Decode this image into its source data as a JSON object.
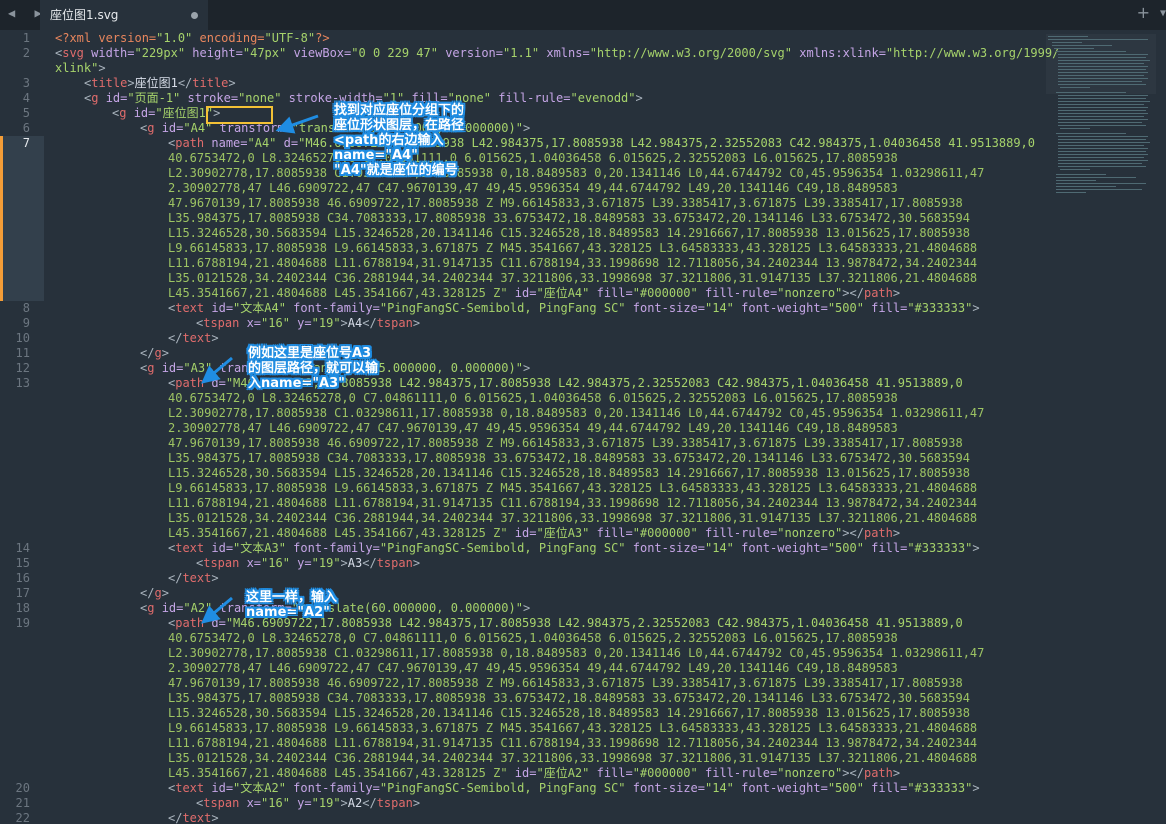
{
  "window": {
    "tab_title": "座位图1.svg",
    "nav_arrows": "◀ ▶",
    "new_tab": "+",
    "tab_menu": "▼"
  },
  "gutter": {
    "lines": [
      "1",
      "2",
      "3",
      "4",
      "5",
      "6",
      "7",
      "8",
      "9",
      "10",
      "11",
      "12",
      "13",
      "14",
      "15",
      "16",
      "17",
      "18",
      "19",
      "20",
      "21",
      "22"
    ],
    "current_line": "7"
  },
  "code": {
    "l1": {
      "a": "<?xml version=",
      "b": "\"1.0\"",
      "c": " encoding=",
      "d": "\"UTF-8\"",
      "e": "?>"
    },
    "l2": {
      "tag": "svg",
      "w_attr": " width=",
      "w_val": "\"229px\"",
      "h_attr": " height=",
      "h_val": "\"47px\"",
      "vb_attr": " viewBox=",
      "vb_val": "\"0 0 229 47\"",
      "v_attr": " version=",
      "v_val": "\"1.1\"",
      "x_attr": " xmlns=",
      "x_val": "\"http://www.w3.org/2000/svg\"",
      "xl_attr": " xmlns:xlink=",
      "xl_val": "\"http://www.w3.org/1999/"
    },
    "l2b": {
      "text": "xlink\"",
      "end": ">"
    },
    "l3": {
      "tag": "title",
      "text": "座位图1",
      "close": "title"
    },
    "l4": {
      "tag": "g",
      "id_attr": " id=",
      "id_val": "\"页面-1\"",
      "st_attr": " stroke=",
      "st_val": "\"none\"",
      "sw_attr": " stroke-width=",
      "sw_val": "\"1\"",
      "f_attr": " fill=",
      "f_val": "\"none\"",
      "fr_attr": " fill-rule=",
      "fr_val": "\"evenodd\""
    },
    "l5": {
      "tag": "g",
      "id_attr": " id=",
      "id_val": "\"座位图1\""
    },
    "l6": {
      "tag": "g",
      "id_attr": " id=",
      "id_val": "\"A4\"",
      "tr_attr": " transform=",
      "tr_val": "\"translate(90.000000, 0.000000)\""
    },
    "l7": {
      "tag": "path",
      "n_attr": " name=",
      "n_val": "\"A4\"",
      "d_attr": " d=",
      "d_val": "\"M46.6909722,17.8085938 L42.984375,17.8085938 L42.984375,2.32552083 C42.984375,1.04036458 41.9513889,0"
    },
    "path_cont": [
      "40.6753472,0 L8.32465278,0 C7.04861111,0 6.015625,1.04036458 6.015625,2.32552083 L6.015625,17.8085938",
      "L2.30902778,17.8085938 C1.03298611,17.8085938 0,18.8489583 0,20.1341146 L0,44.6744792 C0,45.9596354 1.03298611,47",
      "2.30902778,47 L46.6909722,47 C47.9670139,47 49,45.9596354 49,44.6744792 L49,20.1341146 C49,18.8489583",
      "47.9670139,17.8085938 46.6909722,17.8085938 Z M9.66145833,3.671875 L39.3385417,3.671875 L39.3385417,17.8085938",
      "L35.984375,17.8085938 C34.7083333,17.8085938 33.6753472,18.8489583 33.6753472,20.1341146 L33.6753472,30.5683594",
      "L15.3246528,30.5683594 L15.3246528,20.1341146 C15.3246528,18.8489583 14.2916667,17.8085938 13.015625,17.8085938",
      "L9.66145833,17.8085938 L9.66145833,3.671875 Z M45.3541667,43.328125 L3.64583333,43.328125 L3.64583333,21.4804688",
      "L11.6788194,21.4804688 L11.6788194,31.9147135 C11.6788194,33.1998698 12.7118056,34.2402344 13.9878472,34.2402344",
      "L35.0121528,34.2402344 C36.2881944,34.2402344 37.3211806,33.1998698 37.3211806,31.9147135 L37.3211806,21.4804688"
    ],
    "l7_end": {
      "pre": "L45.3541667,21.4804688 L45.3541667,43.328125 Z\"",
      "id_attr": " id=",
      "id_val": "\"座位A4\"",
      "f_attr": " fill=",
      "f_val": "\"#000000\"",
      "fr_attr": " fill-rule=",
      "fr_val": "\"nonzero\"",
      "close": "path"
    },
    "l8": {
      "tag": "text",
      "id_attr": " id=",
      "id_val": "\"文本A4\"",
      "ff_attr": " font-family=",
      "ff_val": "\"PingFangSC-Semibold, PingFang SC\"",
      "fs_attr": " font-size=",
      "fs_val": "\"14\"",
      "fw_attr": " font-weight=",
      "fw_val": "\"500\"",
      "f_attr": " fill=",
      "f_val": "\"#333333\""
    },
    "l9": {
      "tag": "tspan",
      "x_attr": " x=",
      "x_val": "\"16\"",
      "y_attr": " y=",
      "y_val": "\"19\"",
      "text": "A4",
      "close": "tspan"
    },
    "l10": {
      "close": "text"
    },
    "l11": {
      "close": "g"
    },
    "l12": {
      "tag": "g",
      "id_attr": " id=",
      "id_val": "\"A3\"",
      "tr_attr": " transform=",
      "tr_val": "\"translate(75.000000, 0.000000)\""
    },
    "l13": {
      "tag": "path",
      "d_attr": " d=",
      "d_val": "\"M46.6909722,17.8085938 L42.984375,17.8085938 L42.984375,2.32552083 C42.984375,1.04036458 41.9513889,0"
    },
    "l13_end": {
      "id_val": "\"座位A3\""
    },
    "l14": {
      "id_val": "\"文本A3\""
    },
    "l15": {
      "text": "A3"
    },
    "l18": {
      "tag": "g",
      "id_attr": " id=",
      "id_val": "\"A2\"",
      "tr_attr": " transform=",
      "tr_val": "\"translate(60.000000, 0.000000)\""
    },
    "l19": {
      "tag": "path",
      "d_attr": " d=",
      "d_val": "\"M46.6909722,17.8085938 L42.984375,17.8085938 L42.984375,2.32552083 C42.984375,1.04036458 41.9513889,0"
    },
    "l19_end": {
      "id_val": "\"座位A2\""
    },
    "l20": {
      "id_val": "\"文本A2\""
    },
    "l21": {
      "text": "A2"
    }
  },
  "annotations": {
    "a1": [
      "找到对应座位分组下的",
      "座位形状图层，在路径",
      "<path的右边输入",
      "name=\"A4\"",
      "\"A4\"就是座位的编号"
    ],
    "a2": [
      "例如这里是座位号A3",
      "的图层路径，就可以输",
      "入name=\"A3\""
    ],
    "a3": [
      "这里一样，输入",
      "name=\"A2\""
    ]
  },
  "colors": {
    "background": "#27313b",
    "tag": "#e06c6c",
    "attr": "#c5a5e6",
    "string": "#a6d36b",
    "highlight_box": "#f3c136",
    "annotation": "#1f8de3",
    "current_line_marker": "#f49d37"
  }
}
